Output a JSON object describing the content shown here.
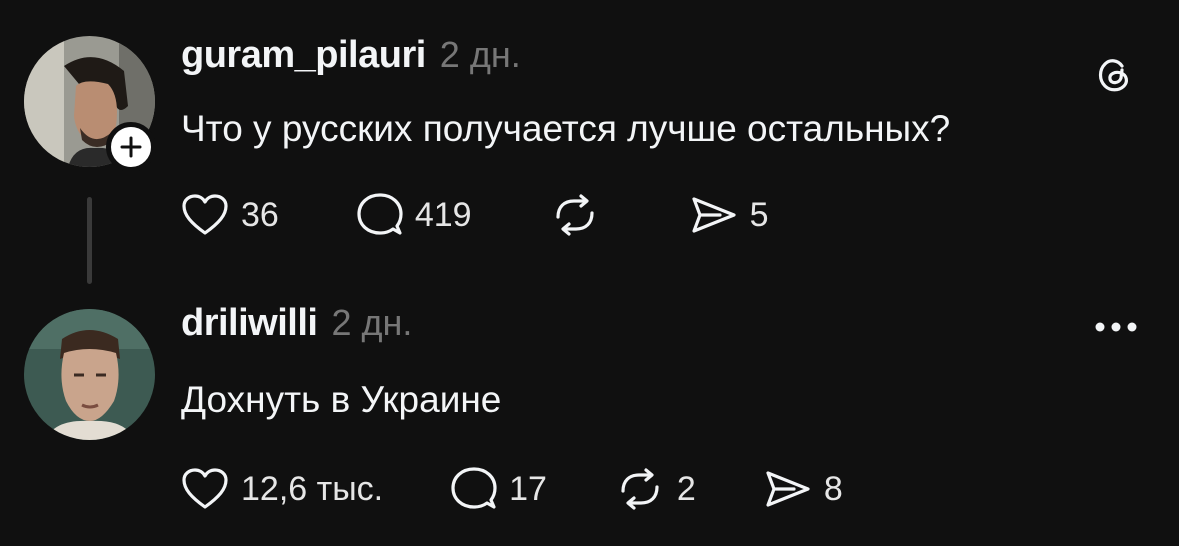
{
  "posts": [
    {
      "username": "guram_pilauri",
      "timestamp": "2 дн.",
      "text": "Что у русских получается лучше остальных?",
      "avatar_icon": "avatar-photo-man-profile",
      "badge_icon": "plus-icon",
      "corner_icon": "threads-logo-icon",
      "actions": {
        "like": {
          "icon": "heart-icon",
          "count": "36"
        },
        "reply": {
          "icon": "speech-bubble-icon",
          "count": "419"
        },
        "repost": {
          "icon": "repost-icon",
          "count": ""
        },
        "share": {
          "icon": "send-icon",
          "count": "5"
        }
      }
    },
    {
      "username": "driliwilli",
      "timestamp": "2 дн.",
      "text": "Дохнуть в Украине",
      "avatar_icon": "avatar-photo-man-portrait",
      "corner_icon": "more-dots-icon",
      "actions": {
        "like": {
          "icon": "heart-icon",
          "count": "12,6 тыс."
        },
        "reply": {
          "icon": "speech-bubble-icon",
          "count": "17"
        },
        "repost": {
          "icon": "repost-icon",
          "count": "2"
        },
        "share": {
          "icon": "send-icon",
          "count": "8"
        }
      }
    }
  ],
  "colors": {
    "background": "#101010",
    "text": "#f3f5f7",
    "muted": "#777777",
    "thread_line": "#3a3a3a"
  }
}
